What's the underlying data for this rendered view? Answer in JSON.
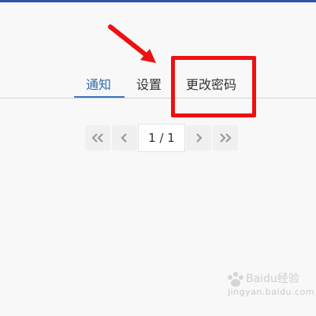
{
  "tabs": [
    {
      "label": "通知",
      "active": true
    },
    {
      "label": "设置",
      "active": false
    },
    {
      "label": "更改密码",
      "active": false
    }
  ],
  "pagination": {
    "current_page": 1,
    "total_pages": 1,
    "display": "1 / 1",
    "buttons": [
      "first-page",
      "previous-page",
      "next-page",
      "last-page"
    ]
  },
  "annotation": {
    "highlight_color": "#ef1010",
    "highlight_target": "更改密码"
  },
  "colors": {
    "accent": "#2f6bb0",
    "top_bar": "#2f54a3",
    "background": "#f8f8f8"
  },
  "watermark": {
    "brand": "Baidu经验",
    "url": "jingyan.baidu.com"
  }
}
